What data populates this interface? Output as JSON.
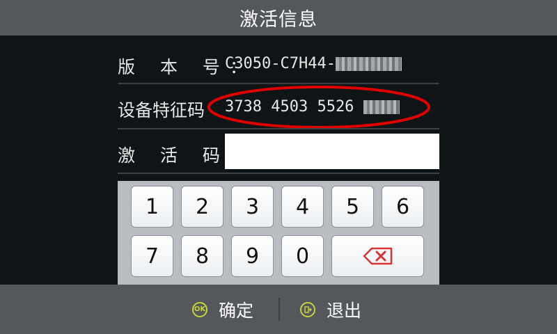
{
  "title": "激活信息",
  "fields": {
    "version": {
      "label": "版 本 号：",
      "value": "C3050-C7H44-"
    },
    "device_code": {
      "label": "设备特征码",
      "value": "3738 4503 5526"
    },
    "activation": {
      "label": "激 活 码：",
      "value": ""
    }
  },
  "keypad": {
    "row1": [
      "1",
      "2",
      "3",
      "4",
      "5",
      "6"
    ],
    "row2": [
      "7",
      "8",
      "9",
      "0"
    ],
    "backspace_icon": "backspace-icon"
  },
  "footer": {
    "ok_icon_text": "OK",
    "confirm_label": "确定",
    "exit_label": "退出"
  },
  "colors": {
    "title_bar": "#54575b",
    "background": "#0f1517",
    "highlight_ellipse": "#e00000",
    "footer_icon": "#c8d43a",
    "backspace": "#d93333"
  }
}
